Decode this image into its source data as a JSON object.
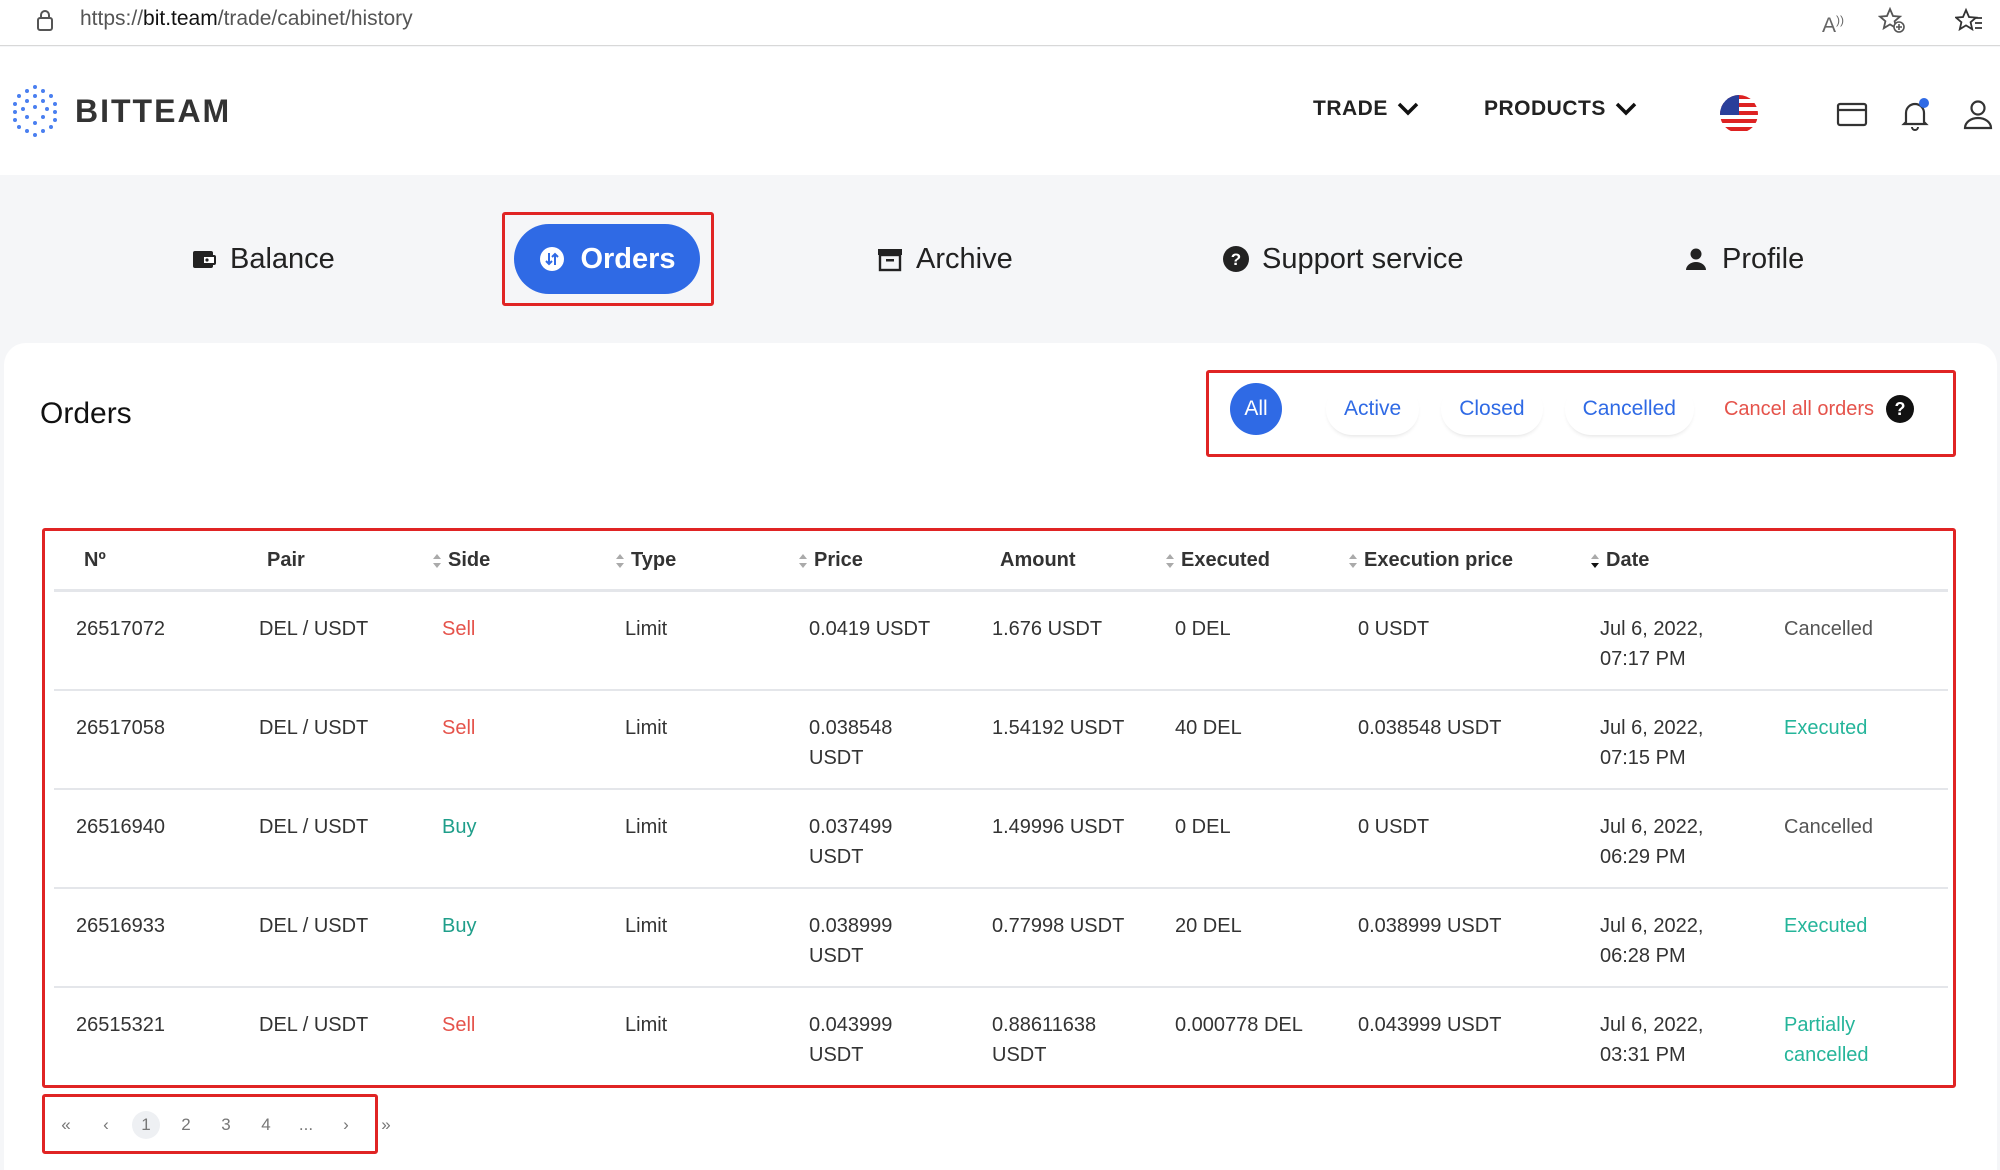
{
  "browser": {
    "url_prefix": "https://",
    "url_host": "bit.team",
    "url_path": "/trade/cabinet/history",
    "readaloud": "A))"
  },
  "header": {
    "logo_text": "BITTEAM",
    "nav": [
      {
        "label": "TRADE"
      },
      {
        "label": "PRODUCTS"
      }
    ]
  },
  "tabs": [
    {
      "label": "Balance",
      "icon": "wallet-icon"
    },
    {
      "label": "Orders",
      "icon": "exchange-icon",
      "active": true
    },
    {
      "label": "Archive",
      "icon": "archive-icon"
    },
    {
      "label": "Support service",
      "icon": "question-icon"
    },
    {
      "label": "Profile",
      "icon": "user-icon"
    }
  ],
  "orders": {
    "title": "Orders",
    "filters": [
      "All",
      "Active",
      "Closed",
      "Cancelled"
    ],
    "active_filter": "All",
    "cancel_all": "Cancel all orders",
    "help": "?"
  },
  "table": {
    "columns": [
      "Nº",
      "Pair",
      "Side",
      "Type",
      "Price",
      "Amount",
      "Executed",
      "Execution price",
      "Date"
    ],
    "rows": [
      {
        "id": "26517072",
        "pair": "DEL / USDT",
        "side": "Sell",
        "type": "Limit",
        "price": "0.0419 USDT",
        "amount": "1.676 USDT",
        "executed": "0 DEL",
        "exec_price": "0 USDT",
        "date": "Jul 6, 2022,",
        "time": "07:17 PM",
        "status": "Cancelled"
      },
      {
        "id": "26517058",
        "pair": "DEL / USDT",
        "side": "Sell",
        "type": "Limit",
        "price": "0.038548",
        "price2": "USDT",
        "amount": "1.54192 USDT",
        "executed": "40 DEL",
        "exec_price": "0.038548 USDT",
        "date": "Jul 6, 2022,",
        "time": "07:15 PM",
        "status": "Executed"
      },
      {
        "id": "26516940",
        "pair": "DEL / USDT",
        "side": "Buy",
        "type": "Limit",
        "price": "0.037499",
        "price2": "USDT",
        "amount": "1.49996 USDT",
        "executed": "0 DEL",
        "exec_price": "0 USDT",
        "date": "Jul 6, 2022,",
        "time": "06:29 PM",
        "status": "Cancelled"
      },
      {
        "id": "26516933",
        "pair": "DEL / USDT",
        "side": "Buy",
        "type": "Limit",
        "price": "0.038999",
        "price2": "USDT",
        "amount": "0.77998 USDT",
        "executed": "20 DEL",
        "exec_price": "0.038999 USDT",
        "date": "Jul 6, 2022,",
        "time": "06:28 PM",
        "status": "Executed"
      },
      {
        "id": "26515321",
        "pair": "DEL / USDT",
        "side": "Sell",
        "type": "Limit",
        "price": "0.043999",
        "price2": "USDT",
        "amount": "0.88611638",
        "amount2": "USDT",
        "executed": "0.000778 DEL",
        "exec_price": "0.043999 USDT",
        "date": "Jul 6, 2022,",
        "time": "03:31 PM",
        "status": "Partially",
        "status2": "cancelled"
      }
    ]
  },
  "pagination": {
    "items": [
      "«",
      "‹",
      "1",
      "2",
      "3",
      "4",
      "...",
      "›",
      "»"
    ],
    "current": "1"
  },
  "colors": {
    "accent": "#2f6ae5",
    "sell": "#e5534b",
    "buy": "#1f9e8a",
    "executed": "#25b59a",
    "highlight": "#e02424"
  }
}
